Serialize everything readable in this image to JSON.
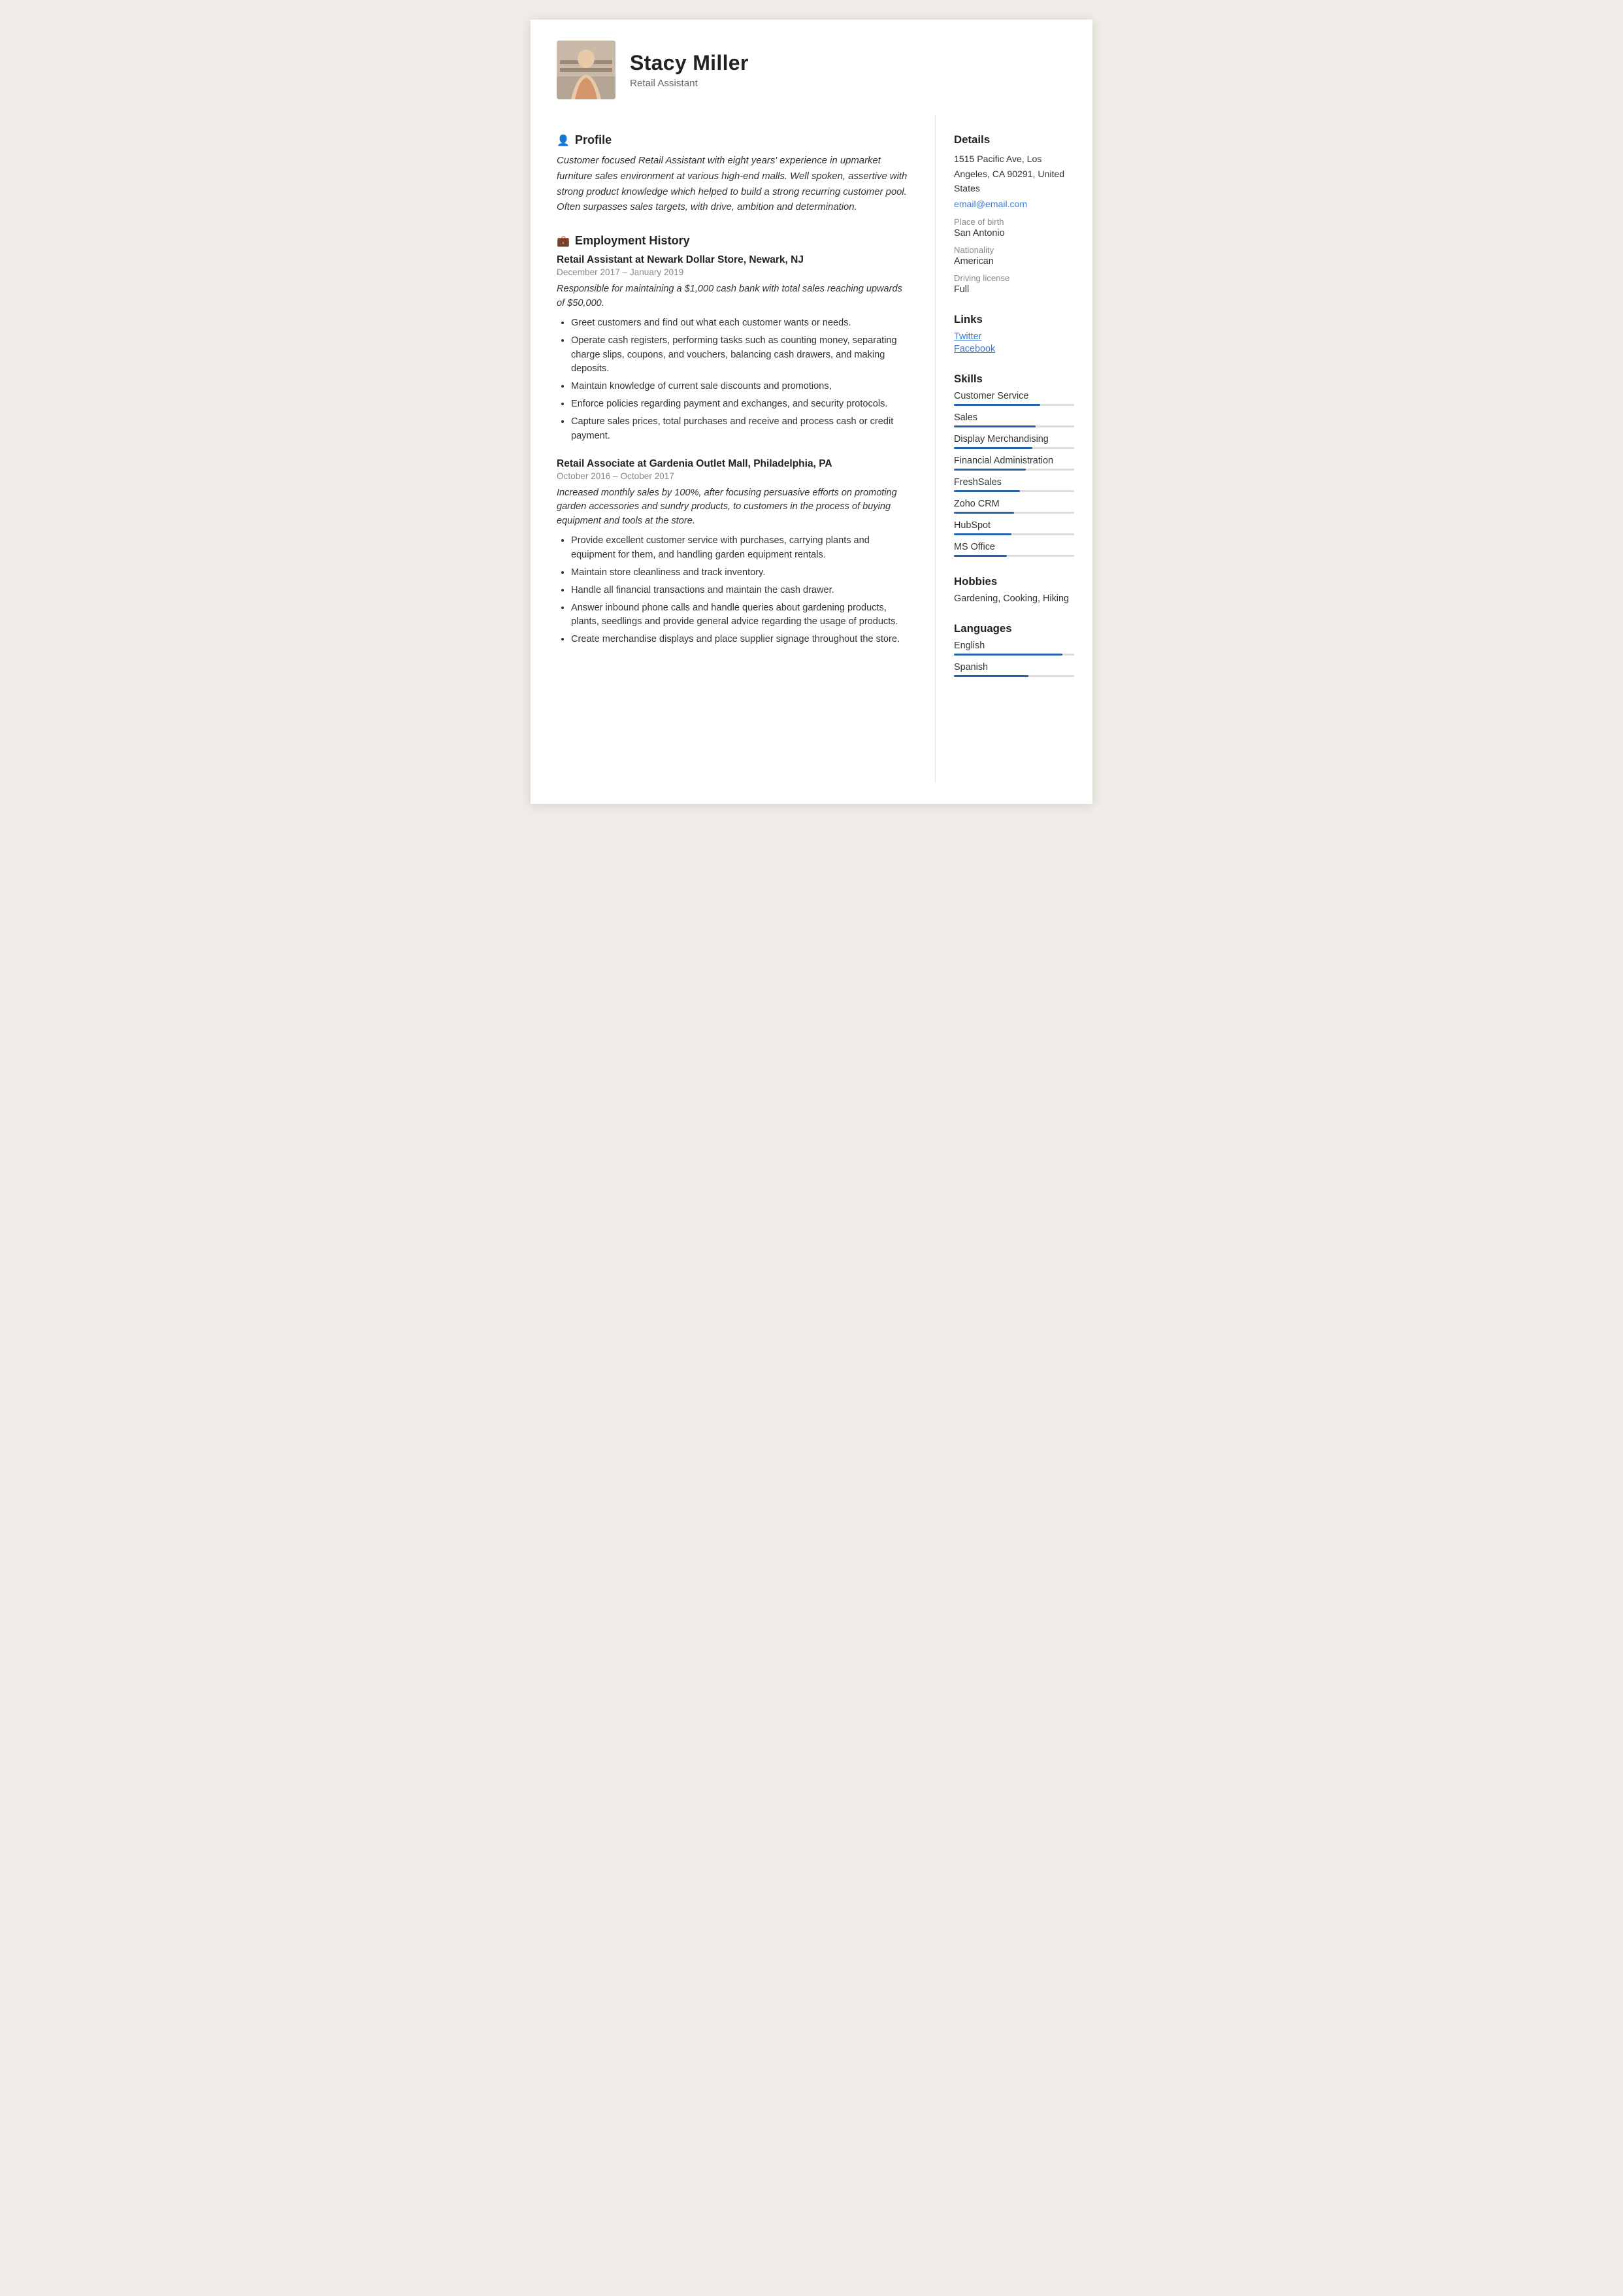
{
  "header": {
    "name": "Stacy Miller",
    "subtitle": "Retail Assistant",
    "avatar_alt": "Stacy Miller photo"
  },
  "profile": {
    "section_title": "Profile",
    "text": "Customer focused Retail Assistant with eight years' experience in upmarket furniture sales environment at various high-end malls. Well spoken, assertive with strong product knowledge which helped to build a strong recurring customer pool. Often surpasses sales targets, with drive, ambition and determination."
  },
  "employment": {
    "section_title": "Employment History",
    "jobs": [
      {
        "title": "Retail Assistant at Newark Dollar Store, Newark, NJ",
        "dates": "December 2017  –  January 2019",
        "summary": "Responsible for maintaining a $1,000 cash bank with total sales reaching upwards of $50,000.",
        "bullets": [
          "Greet customers and find out what each customer wants or needs.",
          "Operate cash registers, performing tasks such as counting money, separating charge slips, coupons, and vouchers, balancing cash drawers, and making deposits.",
          "Maintain knowledge of current sale discounts and promotions,",
          "Enforce policies regarding payment and exchanges, and security protocols.",
          "Capture sales prices, total purchases and receive and process cash or credit payment."
        ]
      },
      {
        "title": "Retail Associate at Gardenia Outlet Mall, Philadelphia, PA",
        "dates": "October 2016  –  October 2017",
        "summary": "Increased monthly sales by 100%, after focusing persuasive efforts on promoting garden accessories and sundry products, to customers in the process of buying equipment and tools at the store.",
        "bullets": [
          "Provide excellent customer service with purchases, carrying plants and equipment for them, and handling garden equipment rentals.",
          "Maintain store cleanliness and track inventory.",
          "Handle all financial transactions and maintain the cash drawer.",
          "Answer inbound phone calls and handle queries about gardening products, plants, seedlings and provide general advice regarding the usage of products.",
          "Create merchandise displays and place supplier signage throughout the store."
        ]
      }
    ]
  },
  "details": {
    "section_title": "Details",
    "address": "1515 Pacific Ave, Los Angeles, CA 90291, United States",
    "email": "email@email.com",
    "place_of_birth_label": "Place of birth",
    "place_of_birth": "San Antonio",
    "nationality_label": "Nationality",
    "nationality": "American",
    "driving_license_label": "Driving license",
    "driving_license": "Full"
  },
  "links": {
    "section_title": "Links",
    "items": [
      {
        "label": "Twitter",
        "url": "#"
      },
      {
        "label": "Facebook",
        "url": "#"
      }
    ]
  },
  "skills": {
    "section_title": "Skills",
    "items": [
      {
        "name": "Customer Service",
        "percent": 72
      },
      {
        "name": "Sales",
        "percent": 68
      },
      {
        "name": "Display Merchandising",
        "percent": 65
      },
      {
        "name": "Financial Administration",
        "percent": 60
      },
      {
        "name": "FreshSales",
        "percent": 55
      },
      {
        "name": "Zoho CRM",
        "percent": 50
      },
      {
        "name": "HubSpot",
        "percent": 48
      },
      {
        "name": "MS Office",
        "percent": 44
      }
    ]
  },
  "hobbies": {
    "section_title": "Hobbies",
    "text": "Gardening, Cooking, Hiking"
  },
  "languages": {
    "section_title": "Languages",
    "items": [
      {
        "name": "English",
        "percent": 90
      },
      {
        "name": "Spanish",
        "percent": 62
      }
    ]
  }
}
